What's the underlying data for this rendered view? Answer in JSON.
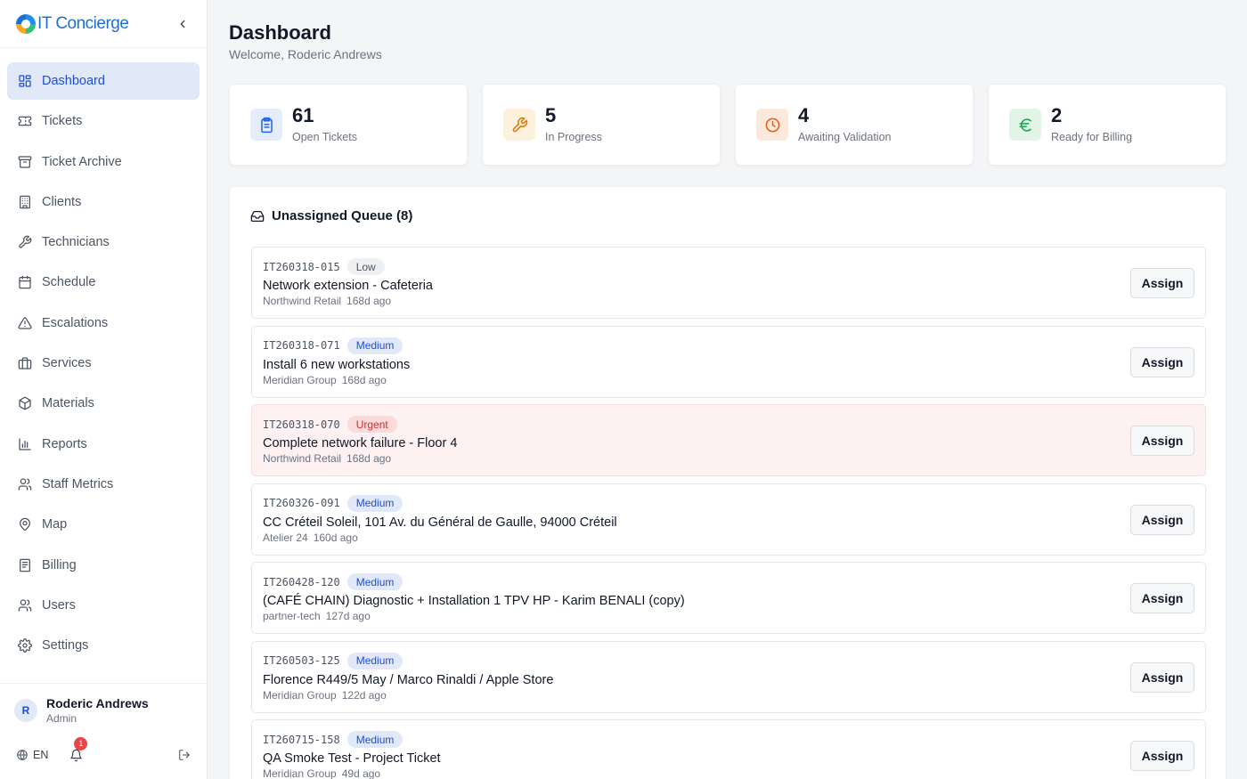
{
  "brand": {
    "name": "IT Concierge"
  },
  "nav": [
    {
      "label": "Dashboard",
      "icon": "dashboard-icon",
      "active": true
    },
    {
      "label": "Tickets",
      "icon": "ticket-icon",
      "active": false
    },
    {
      "label": "Ticket Archive",
      "icon": "archive-icon",
      "active": false
    },
    {
      "label": "Clients",
      "icon": "building-icon",
      "active": false
    },
    {
      "label": "Technicians",
      "icon": "wrench-icon",
      "active": false
    },
    {
      "label": "Schedule",
      "icon": "calendar-icon",
      "active": false
    },
    {
      "label": "Escalations",
      "icon": "warning-icon",
      "active": false
    },
    {
      "label": "Services",
      "icon": "briefcase-icon",
      "active": false
    },
    {
      "label": "Materials",
      "icon": "package-icon",
      "active": false
    },
    {
      "label": "Reports",
      "icon": "bar-chart-icon",
      "active": false
    },
    {
      "label": "Staff Metrics",
      "icon": "users-icon",
      "active": false
    },
    {
      "label": "Map",
      "icon": "map-pin-icon",
      "active": false
    },
    {
      "label": "Billing",
      "icon": "receipt-icon",
      "active": false
    },
    {
      "label": "Users",
      "icon": "users-icon",
      "active": false
    },
    {
      "label": "Settings",
      "icon": "gear-icon",
      "active": false
    }
  ],
  "user": {
    "initial": "R",
    "name": "Roderic Andrews",
    "role": "Admin"
  },
  "footer": {
    "language": "EN",
    "notification_count": "1"
  },
  "page": {
    "title": "Dashboard",
    "subtitle": "Welcome, Roderic Andrews"
  },
  "stats": [
    {
      "value": "61",
      "label": "Open Tickets",
      "icon": "clipboard-icon",
      "color": "#2563eb",
      "bg": "#e6edfa"
    },
    {
      "value": "5",
      "label": "In Progress",
      "icon": "wrench-icon",
      "color": "#d97706",
      "bg": "#fcf1dd"
    },
    {
      "value": "4",
      "label": "Awaiting Validation",
      "icon": "clock-icon",
      "color": "#ea580c",
      "bg": "#fde9dc"
    },
    {
      "value": "2",
      "label": "Ready for Billing",
      "icon": "euro-icon",
      "color": "#16a34a",
      "bg": "#e1f4e7"
    }
  ],
  "queue": {
    "title": "Unassigned Queue (8)",
    "assign_label": "Assign",
    "tickets": [
      {
        "id": "IT260318-015",
        "priority": "Low",
        "title": "Network extension - Cafeteria",
        "client": "Northwind Retail",
        "age": "168d ago"
      },
      {
        "id": "IT260318-071",
        "priority": "Medium",
        "title": "Install 6 new workstations",
        "client": "Meridian Group",
        "age": "168d ago"
      },
      {
        "id": "IT260318-070",
        "priority": "Urgent",
        "title": "Complete network failure - Floor 4",
        "client": "Northwind Retail",
        "age": "168d ago"
      },
      {
        "id": "IT260326-091",
        "priority": "Medium",
        "title": "CC Créteil Soleil, 101 Av. du Général de Gaulle, 94000 Créteil",
        "client": "Atelier 24",
        "age": "160d ago"
      },
      {
        "id": "IT260428-120",
        "priority": "Medium",
        "title": "(CAFÉ CHAIN) Diagnostic + Installation 1 TPV HP - Karim BENALI (copy)",
        "client": "partner-tech",
        "age": "127d ago"
      },
      {
        "id": "IT260503-125",
        "priority": "Medium",
        "title": "Florence R449/5 May / Marco Rinaldi / Apple Store",
        "client": "Meridian Group",
        "age": "122d ago"
      },
      {
        "id": "IT260715-158",
        "priority": "Medium",
        "title": "QA Smoke Test - Project Ticket",
        "client": "Meridian Group",
        "age": "49d ago"
      }
    ]
  }
}
